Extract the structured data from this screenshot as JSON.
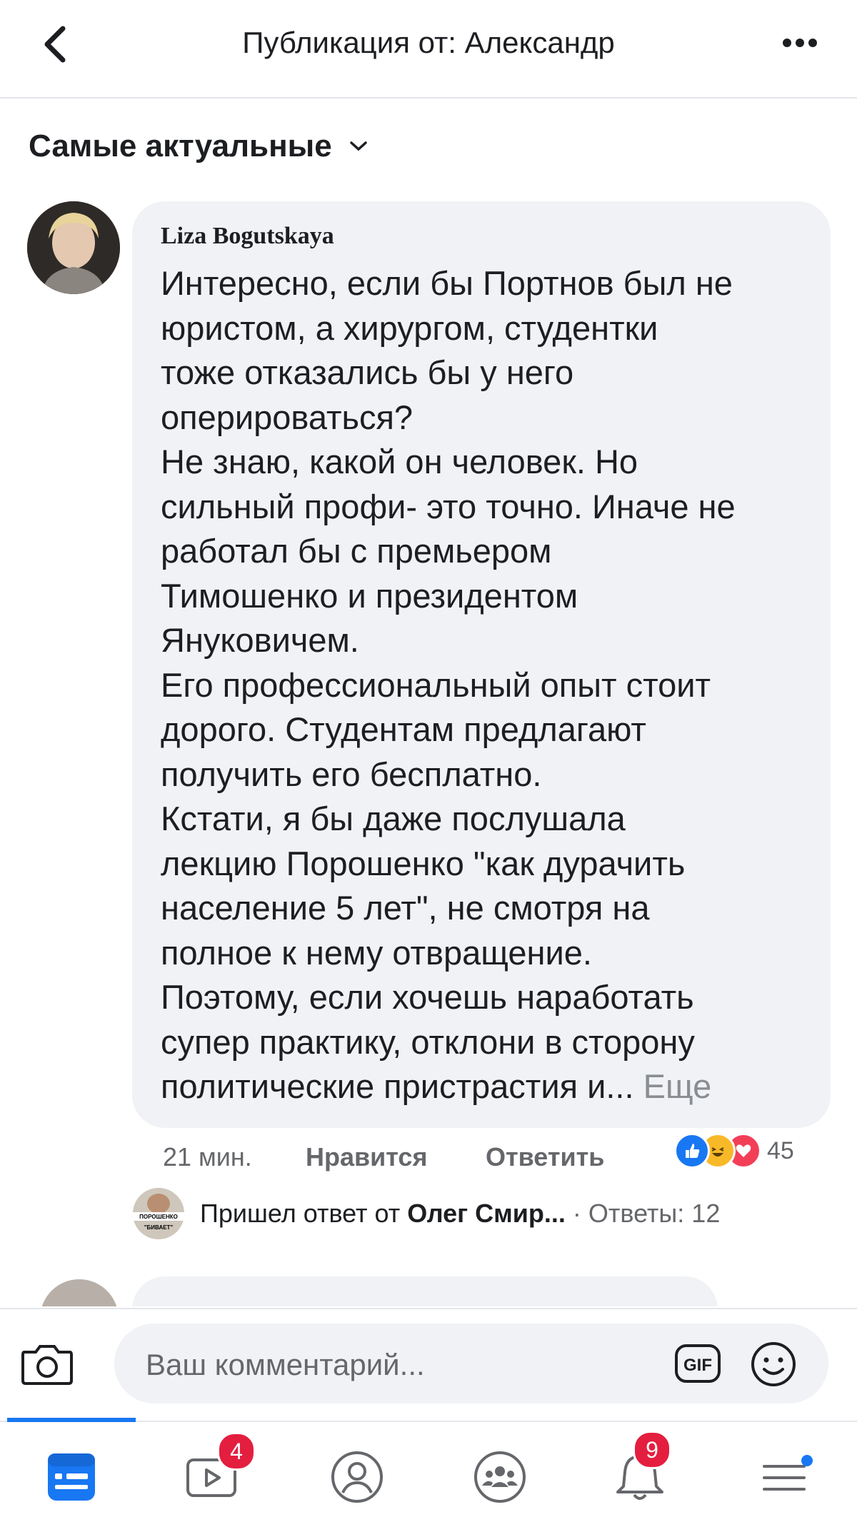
{
  "header": {
    "title": "Публикация от: Александр"
  },
  "sort": {
    "label": "Самые актуальные"
  },
  "comment": {
    "author": "Liza Bogutskaya",
    "lines": [
      "Интересно, если бы Портнов был не",
      "юристом, а хирургом, студентки",
      "тоже отказались бы у него",
      "оперироваться?",
      "Не знаю, какой он человек. Но",
      "сильный профи- это точно. Иначе не",
      "работал бы с премьером",
      "Тимошенко и президентом",
      "Януковичем.",
      "Его профессиональный опыт стоит",
      "дорого. Студентам предлагают",
      "получить его бесплатно.",
      "Кстати, я бы даже послушала",
      "лекцию Порошенко \"как дурачить",
      "население 5 лет\", не смотря на",
      "полное к нему отвращение.",
      "Поэтому, если хочешь наработать",
      "супер практику, отклони в сторону"
    ],
    "last_line": "политические пристрастия и...",
    "more_label": "Еще",
    "time": "21 мин.",
    "like_label": "Нравится",
    "reply_label": "Ответить",
    "reaction_count": "45"
  },
  "reply_summary": {
    "prefix": "Пришел ответ от ",
    "name": "Олег Смир...",
    "replies": " · Ответы: 12",
    "avatar_text_top": "ПОРОШЕНКО",
    "avatar_text_bottom": "\"БИВАЕТ\""
  },
  "composer": {
    "placeholder": "Ваш комментарий...",
    "gif_label": "GIF"
  },
  "tabs": [
    {
      "name": "news-feed",
      "badge": ""
    },
    {
      "name": "watch",
      "badge": "4"
    },
    {
      "name": "profile",
      "badge": ""
    },
    {
      "name": "groups",
      "badge": ""
    },
    {
      "name": "notifications",
      "badge": "9"
    },
    {
      "name": "menu",
      "badge": ""
    }
  ],
  "colors": {
    "accent": "#1877f2",
    "badge": "#e41e3f",
    "bubble": "#f0f2f5",
    "muted": "#65676b"
  }
}
